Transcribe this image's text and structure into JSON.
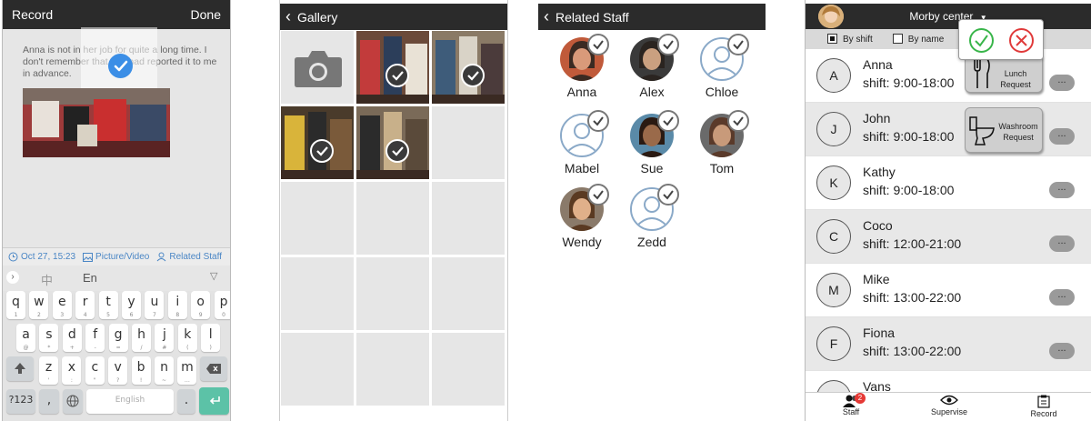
{
  "record": {
    "title": "Record",
    "done": "Done",
    "note_prefix": "Anna",
    "note_text": " is not in her job for quite a long time. I don't remember that she had reported it to me in advance.",
    "date": "Oct 27, 15:23",
    "picture_video": "Picture/Video",
    "related_staff": "Related Staff",
    "ime": {
      "chinese": "中",
      "english": "En",
      "space": "English"
    },
    "keyboard": {
      "row1": [
        [
          "q",
          "1"
        ],
        [
          "w",
          "2"
        ],
        [
          "e",
          "3"
        ],
        [
          "r",
          "4"
        ],
        [
          "t",
          "5"
        ],
        [
          "y",
          "6"
        ],
        [
          "u",
          "7"
        ],
        [
          "i",
          "8"
        ],
        [
          "o",
          "9"
        ],
        [
          "p",
          "0"
        ]
      ],
      "row2": [
        [
          "a",
          "@"
        ],
        [
          "s",
          "*"
        ],
        [
          "d",
          "+"
        ],
        [
          "f",
          "-"
        ],
        [
          "g",
          "="
        ],
        [
          "h",
          "/"
        ],
        [
          "j",
          "#"
        ],
        [
          "k",
          "("
        ],
        [
          "l",
          ")"
        ]
      ],
      "row3": [
        [
          "z",
          "'"
        ],
        [
          "x",
          ":"
        ],
        [
          "c",
          "\""
        ],
        [
          "v",
          "?"
        ],
        [
          "b",
          "!"
        ],
        [
          "n",
          "~"
        ],
        [
          "m",
          "…"
        ]
      ],
      "numbers": "?123",
      "period": ".",
      "comma": ","
    }
  },
  "gallery": {
    "title": "Gallery"
  },
  "related": {
    "title": "Related Staff",
    "staff": [
      "Anna",
      "Alex",
      "Chloe",
      "Mabel",
      "Sue",
      "Tom",
      "Wendy",
      "Zedd"
    ]
  },
  "staff_list": {
    "center": "Morby center",
    "by_shift": "By shift",
    "by_name": "By name",
    "lunch_request": "Lunch Request",
    "washroom_request": "Washroom Request",
    "more": "...",
    "rows": [
      {
        "initial": "A",
        "name": "Anna",
        "shift": "shift: 9:00-18:00"
      },
      {
        "initial": "J",
        "name": "John",
        "shift": "shift: 9:00-18:00"
      },
      {
        "initial": "K",
        "name": "Kathy",
        "shift": "shift: 9:00-18:00"
      },
      {
        "initial": "C",
        "name": "Coco",
        "shift": "shift: 12:00-21:00"
      },
      {
        "initial": "M",
        "name": "Mike",
        "shift": "shift: 13:00-22:00"
      },
      {
        "initial": "F",
        "name": "Fiona",
        "shift": "shift: 13:00-22:00"
      },
      {
        "initial": "V",
        "name": "Vans",
        "shift": ""
      }
    ],
    "tabs": {
      "staff": "Staff",
      "supervise": "Supervise",
      "record": "Record",
      "badge": "2"
    }
  }
}
